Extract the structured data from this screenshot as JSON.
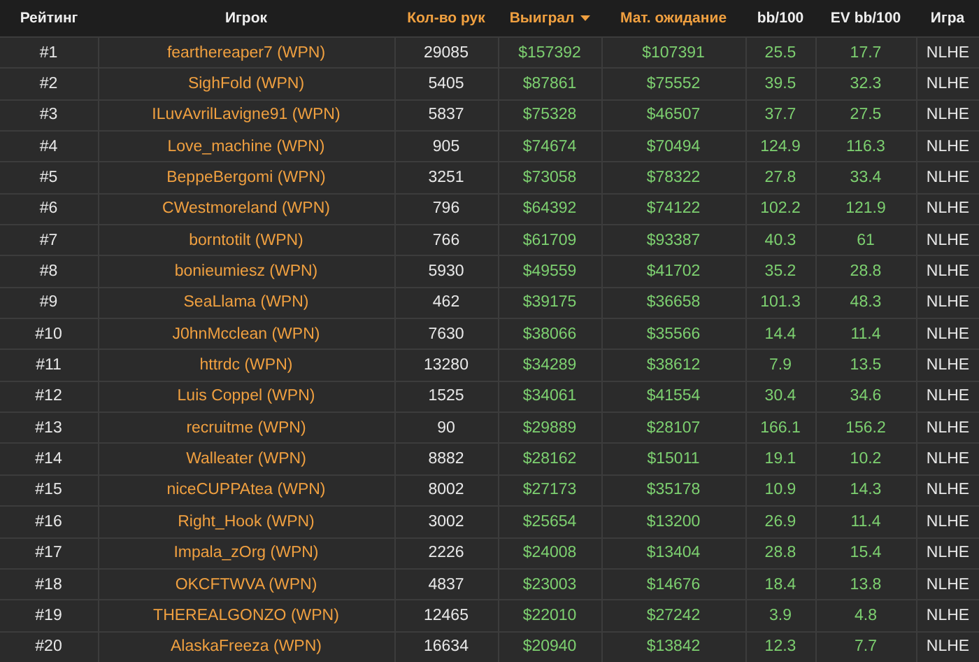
{
  "table": {
    "columns": [
      {
        "label": "Рейтинг",
        "kind": "rank",
        "sortable": false,
        "sorted": false
      },
      {
        "label": "Игрок",
        "kind": "player",
        "sortable": false,
        "sorted": false
      },
      {
        "label": "Кол-во рук",
        "kind": "plain",
        "sortable": true,
        "sorted": false
      },
      {
        "label": "Выиграл",
        "kind": "money",
        "sortable": true,
        "sorted": true
      },
      {
        "label": "Мат. ожидание",
        "kind": "money",
        "sortable": true,
        "sorted": false
      },
      {
        "label": "bb/100",
        "kind": "money",
        "sortable": false,
        "sorted": false
      },
      {
        "label": "EV bb/100",
        "kind": "money",
        "sortable": false,
        "sorted": false
      },
      {
        "label": "Игра",
        "kind": "plain",
        "sortable": false,
        "sorted": false
      }
    ],
    "rows": [
      [
        "#1",
        "fearthereaper7 (WPN)",
        "29085",
        "$157392",
        "$107391",
        "25.5",
        "17.7",
        "NLHE"
      ],
      [
        "#2",
        "SighFold (WPN)",
        "5405",
        "$87861",
        "$75552",
        "39.5",
        "32.3",
        "NLHE"
      ],
      [
        "#3",
        "ILuvAvrilLavigne91 (WPN)",
        "5837",
        "$75328",
        "$46507",
        "37.7",
        "27.5",
        "NLHE"
      ],
      [
        "#4",
        "Love_machine (WPN)",
        "905",
        "$74674",
        "$70494",
        "124.9",
        "116.3",
        "NLHE"
      ],
      [
        "#5",
        "BeppeBergomi (WPN)",
        "3251",
        "$73058",
        "$78322",
        "27.8",
        "33.4",
        "NLHE"
      ],
      [
        "#6",
        "CWestmoreland (WPN)",
        "796",
        "$64392",
        "$74122",
        "102.2",
        "121.9",
        "NLHE"
      ],
      [
        "#7",
        "borntotilt (WPN)",
        "766",
        "$61709",
        "$93387",
        "40.3",
        "61",
        "NLHE"
      ],
      [
        "#8",
        "bonieumiesz (WPN)",
        "5930",
        "$49559",
        "$41702",
        "35.2",
        "28.8",
        "NLHE"
      ],
      [
        "#9",
        "SeaLlama (WPN)",
        "462",
        "$39175",
        "$36658",
        "101.3",
        "48.3",
        "NLHE"
      ],
      [
        "#10",
        "J0hnMcclean (WPN)",
        "7630",
        "$38066",
        "$35566",
        "14.4",
        "11.4",
        "NLHE"
      ],
      [
        "#11",
        "httrdc (WPN)",
        "13280",
        "$34289",
        "$38612",
        "7.9",
        "13.5",
        "NLHE"
      ],
      [
        "#12",
        "Luis Coppel (WPN)",
        "1525",
        "$34061",
        "$41554",
        "30.4",
        "34.6",
        "NLHE"
      ],
      [
        "#13",
        "recruitme (WPN)",
        "90",
        "$29889",
        "$28107",
        "166.1",
        "156.2",
        "NLHE"
      ],
      [
        "#14",
        "Walleater (WPN)",
        "8882",
        "$28162",
        "$15011",
        "19.1",
        "10.2",
        "NLHE"
      ],
      [
        "#15",
        "niceCUPPAtea (WPN)",
        "8002",
        "$27173",
        "$35178",
        "10.9",
        "14.3",
        "NLHE"
      ],
      [
        "#16",
        "Right_Hook (WPN)",
        "3002",
        "$25654",
        "$13200",
        "26.9",
        "11.4",
        "NLHE"
      ],
      [
        "#17",
        "Impala_zOrg (WPN)",
        "2226",
        "$24008",
        "$13404",
        "28.8",
        "15.4",
        "NLHE"
      ],
      [
        "#18",
        "OKCFTWVA (WPN)",
        "4837",
        "$23003",
        "$14676",
        "18.4",
        "13.8",
        "NLHE"
      ],
      [
        "#19",
        "THEREALGONZO (WPN)",
        "12465",
        "$22010",
        "$27242",
        "3.9",
        "4.8",
        "NLHE"
      ],
      [
        "#20",
        "AlaskaFreeza (WPN)",
        "16634",
        "$20940",
        "$13842",
        "12.3",
        "7.7",
        "NLHE"
      ]
    ]
  }
}
